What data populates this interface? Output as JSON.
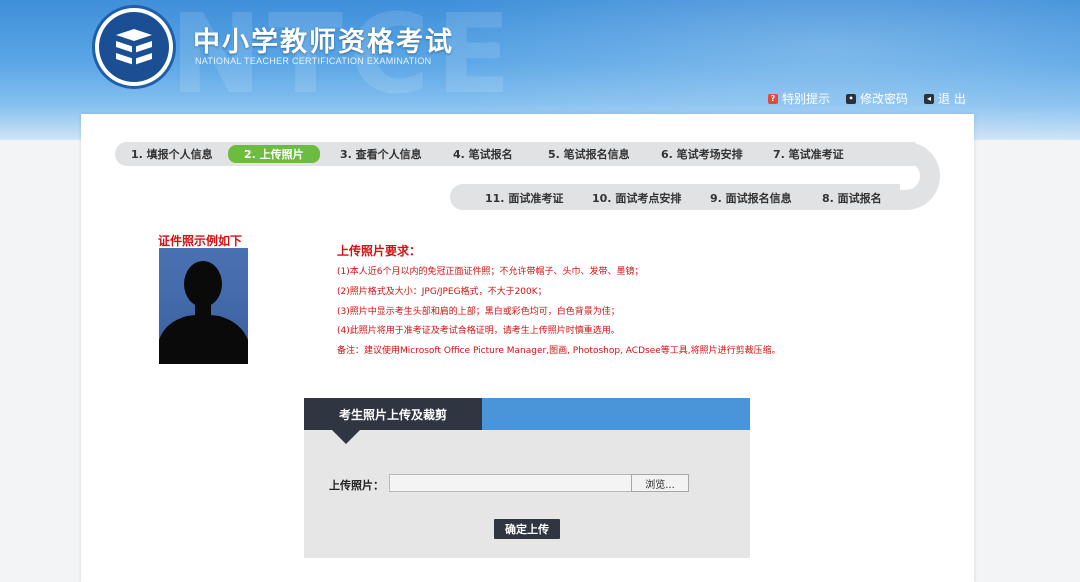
{
  "header": {
    "title": "中小学教师资格考试",
    "subtitle": "NATIONAL TEACHER CERTIFICATION EXAMINATION",
    "watermark": "NTCE",
    "links": [
      {
        "label": "特别提示",
        "icon": "notice-icon",
        "color": "#e24b3b"
      },
      {
        "label": "修改密码",
        "icon": "password-icon",
        "color": "#2b3138"
      },
      {
        "label": "退 出",
        "icon": "logout-icon",
        "color": "#2b3138"
      }
    ]
  },
  "steps": {
    "row1": [
      "1. 填报个人信息",
      "2. 上传照片",
      "3. 查看个人信息",
      "4. 笔试报名",
      "5. 笔试报名信息",
      "6. 笔试考场安排",
      "7. 笔试准考证"
    ],
    "row2": [
      "11. 面试准考证",
      "10. 面试考点安排",
      "9. 面试报名信息",
      "8. 面试报名"
    ],
    "active_index": 1
  },
  "example": {
    "label": "证件照示例如下"
  },
  "requirements": {
    "title": "上传照片要求：",
    "lines": [
      "(1)本人近6个月以内的免冠正面证件照；不允许带帽子、头巾、发带、墨镜；",
      "(2)照片格式及大小：JPG/JPEG格式，不大于200K；",
      "(3)照片中显示考生头部和肩的上部；黑白或彩色均可，白色背景为佳；",
      "(4)此照片将用于准考证及考试合格证明，请考生上传照片时慎重选用。",
      "备注：建议使用Microsoft Office Picture Manager,图画, Photoshop, ACDsee等工具,将照片进行剪裁压缩。"
    ]
  },
  "upload": {
    "heading": "考生照片上传及裁剪",
    "file_label": "上传照片：",
    "file_value": "",
    "browse_label": "浏览...",
    "submit_label": "确定上传"
  },
  "colors": {
    "header_blue": "#4a94d9",
    "active_step": "#6cbd3f",
    "requirement_red": "#d01212",
    "dark_button": "#2f3641"
  }
}
